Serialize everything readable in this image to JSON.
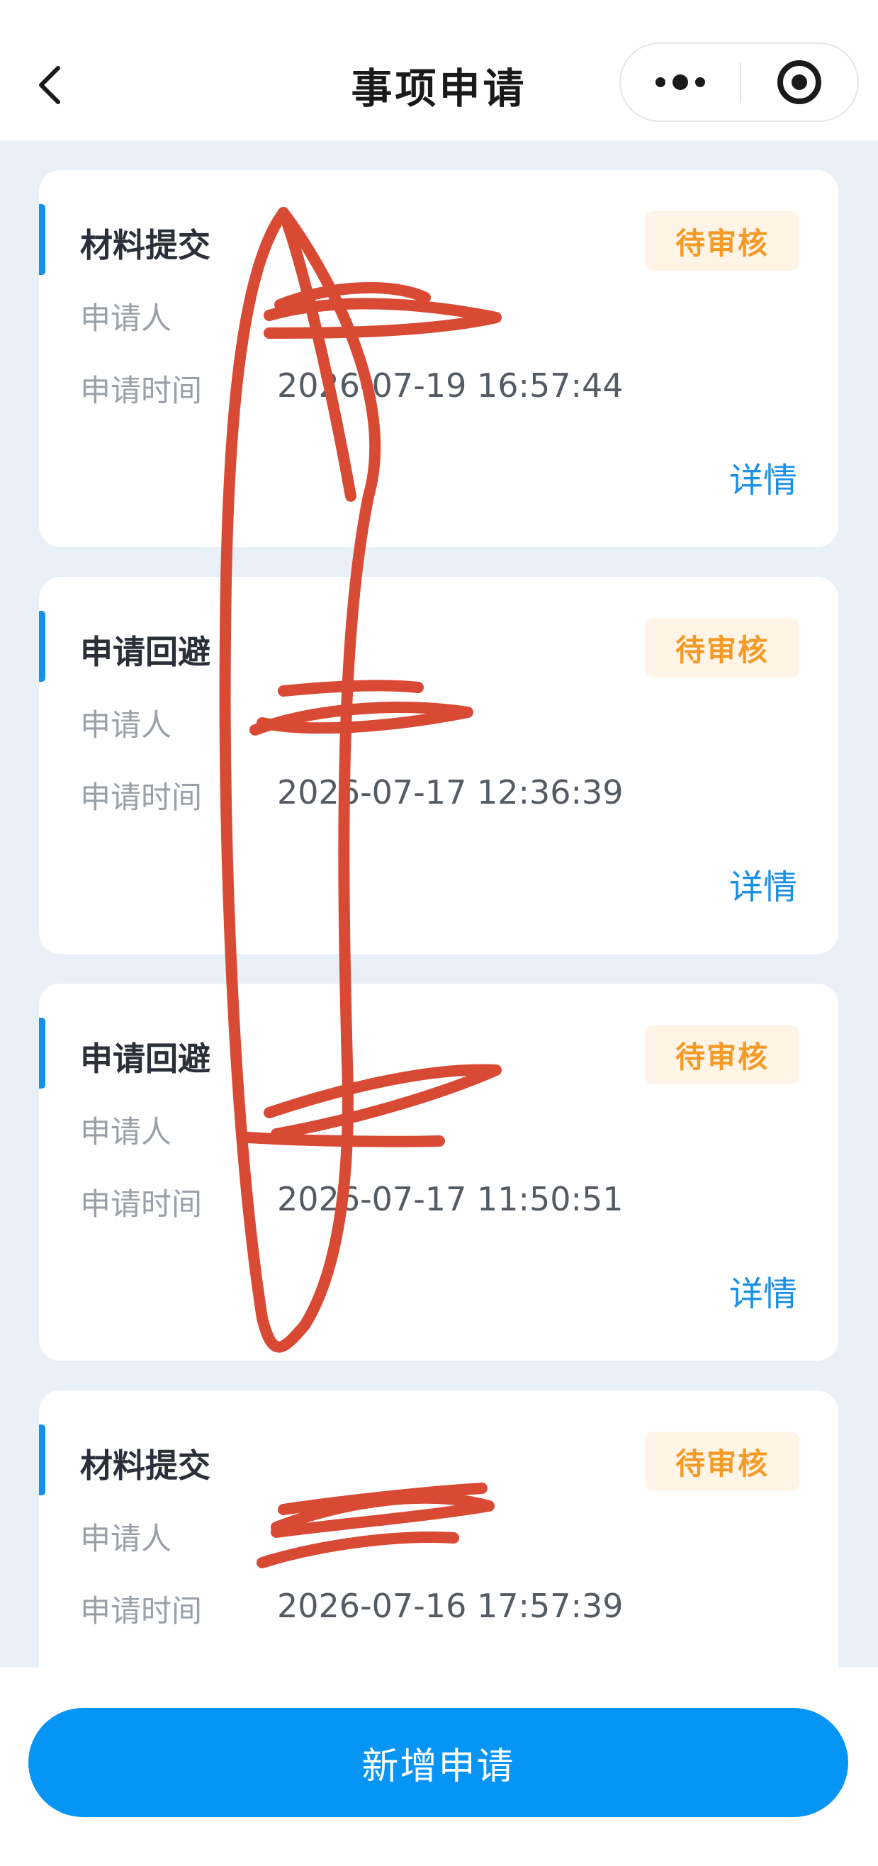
{
  "navbar": {
    "title": "事项申请",
    "back_icon": "chevron-left-icon",
    "more_icon": "more-dots-icon",
    "close_icon": "target-close-icon"
  },
  "labels": {
    "applicant": "申请人",
    "apply_time": "申请时间",
    "detail": "详情"
  },
  "colors": {
    "accent": "#0795f5",
    "status_pending_text": "#f39b26",
    "status_pending_bg": "#fff4e5",
    "link": "#1a8fe3",
    "scribble": "#d94a35"
  },
  "cards": [
    {
      "title": "材料提交",
      "status": "待审核",
      "applicant": "",
      "apply_time": "2026-07-19 16:57:44"
    },
    {
      "title": "申请回避",
      "status": "待审核",
      "applicant": "",
      "apply_time": "2026-07-17 12:36:39"
    },
    {
      "title": "申请回避",
      "status": "待审核",
      "applicant": "",
      "apply_time": "2026-07-17 11:50:51"
    },
    {
      "title": "材料提交",
      "status": "待审核",
      "applicant": "",
      "apply_time": "2026-07-16 17:57:39"
    }
  ],
  "footer": {
    "add_button": "新增申请"
  }
}
